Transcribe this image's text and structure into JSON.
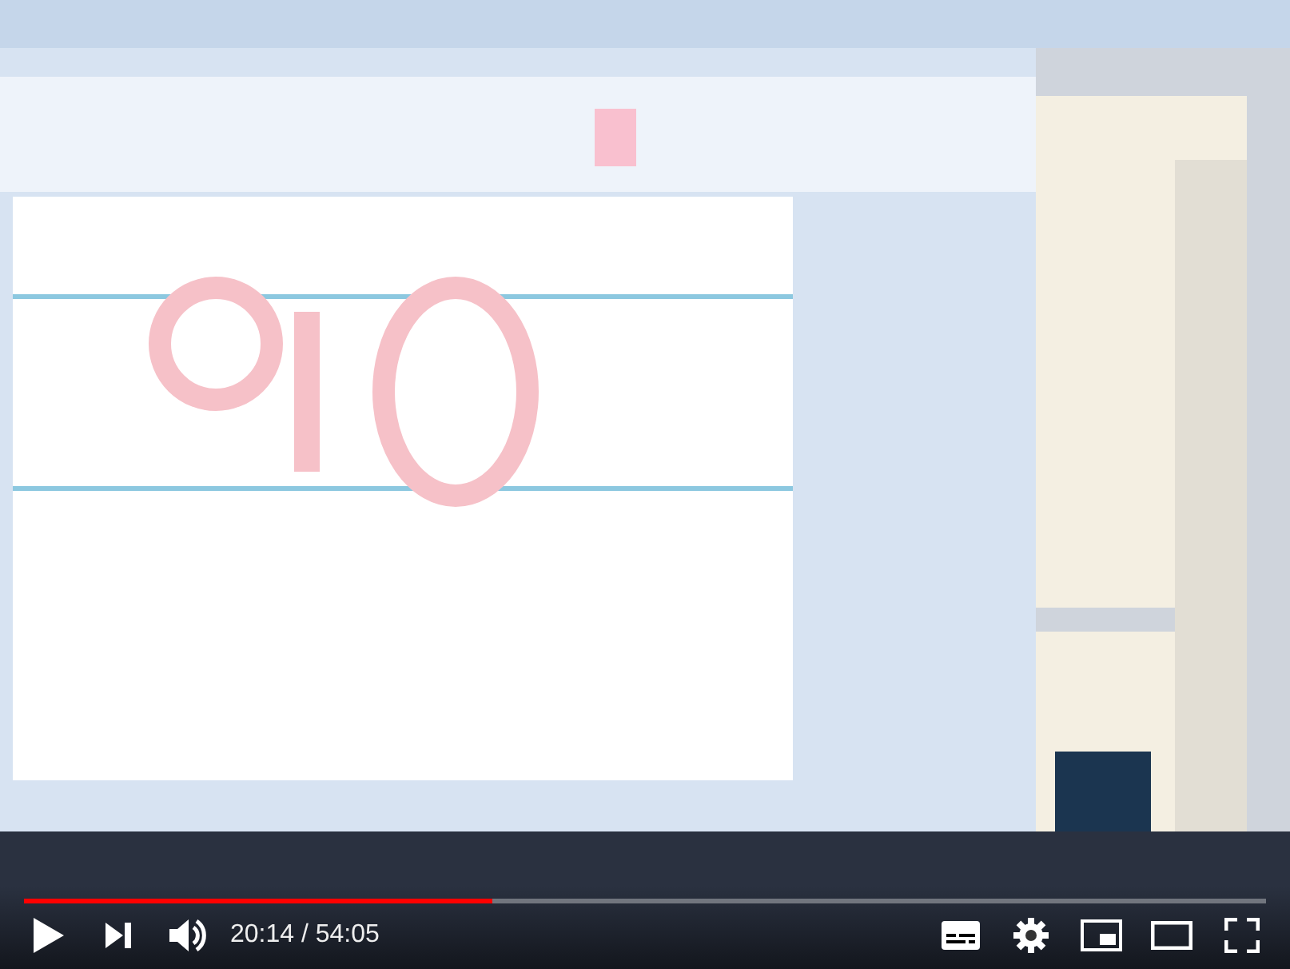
{
  "player": {
    "progress": {
      "level": 0.377
    },
    "time": "20:14 / 54:05"
  }
}
